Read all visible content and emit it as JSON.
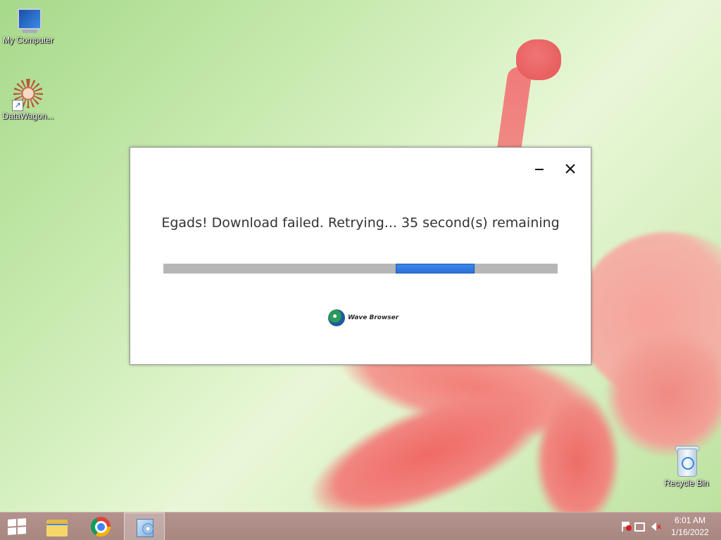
{
  "desktop": {
    "icons": [
      {
        "label": "My Computer",
        "icon": "computer-icon"
      },
      {
        "label": "DataWagon...",
        "icon": "datawagon-icon"
      },
      {
        "label": "Recycle Bin",
        "icon": "recycle-bin-icon"
      }
    ]
  },
  "dialog": {
    "message": "Egads! Download failed. Retrying... 35 second(s) remaining",
    "progress": {
      "fill_start_fraction": 0.59,
      "fill_width_fraction": 0.2
    },
    "brand": "Wave Browser",
    "minimize_icon": "minimize-icon",
    "close_icon": "close-icon",
    "close_glyph": "✕"
  },
  "taskbar": {
    "items": [
      {
        "name": "start",
        "icon": "windows-logo-icon"
      },
      {
        "name": "file-explorer",
        "icon": "folder-icon"
      },
      {
        "name": "chrome",
        "icon": "chrome-icon"
      },
      {
        "name": "installer",
        "icon": "installer-icon"
      }
    ],
    "tray": {
      "icons": [
        "action-center-flag-icon",
        "network-icon",
        "volume-muted-icon"
      ],
      "time": "6:01 AM",
      "date": "1/16/2022"
    }
  },
  "colors": {
    "progress_track": "#b6b6b6",
    "progress_fill": "#3d86ea",
    "taskbar": "#b3928d"
  }
}
